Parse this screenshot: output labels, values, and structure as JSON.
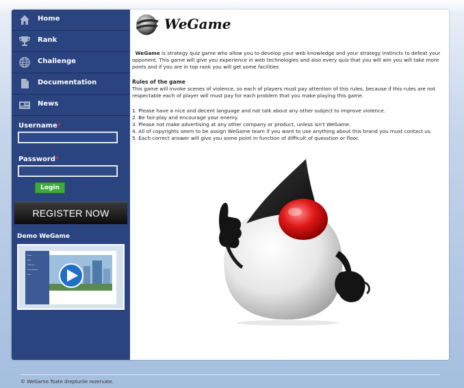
{
  "sidebar": {
    "nav": [
      {
        "label": "Home",
        "icon": "home-icon"
      },
      {
        "label": "Rank",
        "icon": "trophy-icon"
      },
      {
        "label": "Challenge",
        "icon": "globe-icon"
      },
      {
        "label": "Documentation",
        "icon": "document-icon"
      },
      {
        "label": "News",
        "icon": "newspaper-icon"
      }
    ],
    "login": {
      "username_label": "Username",
      "password_label": "Password",
      "required_mark": "*",
      "username_value": "",
      "password_value": "",
      "login_label": "Login"
    },
    "register_label": "REGISTER NOW",
    "demo": {
      "title": "Demo WeGame",
      "thumbnail_menu": [
        "Home",
        "Rank",
        "Challenge",
        "Documentation",
        "News"
      ]
    }
  },
  "main": {
    "logo_text": "WeGame",
    "intro_brand": "WeGame",
    "intro_text": " is strategy quiz game who allow you to develop your web knowledge and your strategy instincts to defeat your opponent. This game will give you experience in web technologies and also every quiz that you will win you will take more ponts and if you are in top rank you will get some facilities",
    "rules_heading": "Rules of the game",
    "rules_intro": "This game will invoke scenes of violence, so each of players must pay attention of this rules, because if this rules are not respectable each of player will must pay for each problem that you make playing this game.",
    "rules": [
      "1. Please have a nice and decent language and not talk about any other subject to improve violence.",
      "2. Be fair-play and encourage your enemy.",
      "3. Please not make advertising at any other company or product, unless isn't WeGame.",
      "4. All of copyrights seem to be assign WeGame team if you want to use anything about this brand you must contact us.",
      "5. Each correct answer will give you some point in function of difficult of quesstion or floor."
    ],
    "mascot": "duke-thumbs-up-mascot"
  },
  "footer": {
    "text": "© WeGame.Toate drepturile rezervate."
  },
  "colors": {
    "sidebar": "#2a4480",
    "login_button": "#3eaa3e",
    "required_mark": "#e0322e",
    "register_button": "#1a1a1a"
  }
}
